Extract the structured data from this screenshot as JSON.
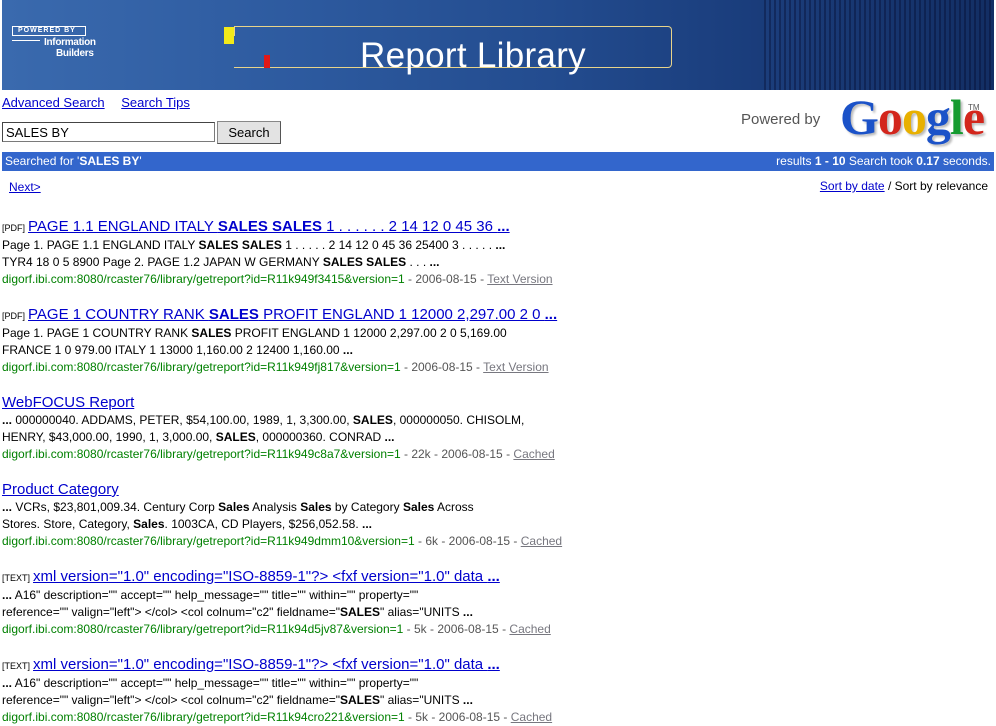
{
  "banner": {
    "logo_line1": "POWERED BY",
    "logo_line2": "Information",
    "logo_line3": "Builders",
    "title": "Report Library"
  },
  "links": {
    "advanced": "Advanced Search",
    "tips": "Search Tips"
  },
  "search": {
    "value": "SALES BY",
    "button": "Search"
  },
  "powered": {
    "text": "Powered by",
    "google": [
      "G",
      "o",
      "o",
      "g",
      "l",
      "e"
    ],
    "tm": "TM"
  },
  "bar": {
    "searched_prefix": "Searched for '",
    "query": "SALES BY",
    "searched_suffix": "'",
    "results_prefix": "results ",
    "range": "1 - 10",
    "took_prefix": " Search took ",
    "seconds": "0.17",
    "took_suffix": " seconds."
  },
  "nav": {
    "next": "Next>",
    "sort_date": "Sort by date",
    "sort_rel": " / Sort by relevance"
  },
  "results": [
    {
      "type": "[PDF]",
      "title": [
        [
          "PAGE 1.1 ENGLAND ITALY ",
          false
        ],
        [
          "SALES SALES",
          true
        ],
        [
          " 1 . . . . . . 2 14 12 0 45 36 ",
          false
        ],
        [
          "...",
          true
        ]
      ],
      "lines": [
        [
          [
            "Page 1. PAGE 1.1 ENGLAND ITALY ",
            false
          ],
          [
            "SALES SALES",
            true
          ],
          [
            " 1 . . . . . 2 14 12 0 45 36 25400 3 . . . . . ",
            false
          ],
          [
            "...",
            true
          ]
        ],
        [
          [
            "TYR4 18 0 5 8900 Page 2. PAGE 1.2 JAPAN W GERMANY ",
            false
          ],
          [
            "SALES SALES",
            true
          ],
          [
            " . . . ",
            false
          ],
          [
            "...",
            true
          ]
        ]
      ],
      "url": "digorf.ibi.com:8080/rcaster76/library/getreport?id=R11k949f3415&version=1",
      "meta": " - 2006-08-15 - ",
      "link": "Text Version"
    },
    {
      "type": "[PDF]",
      "title": [
        [
          "PAGE 1 COUNTRY RANK ",
          false
        ],
        [
          "SALES",
          true
        ],
        [
          " PROFIT ENGLAND 1 12000 2,297.00 2 0 ",
          false
        ],
        [
          "...",
          true
        ]
      ],
      "lines": [
        [
          [
            "Page 1. PAGE 1 COUNTRY RANK ",
            false
          ],
          [
            "SALES",
            true
          ],
          [
            " PROFIT ENGLAND 1 12000 2,297.00 2 0 5,169.00",
            false
          ]
        ],
        [
          [
            "FRANCE 1 0 979.00 ITALY 1 13000 1,160.00 2 12400 1,160.00 ",
            false
          ],
          [
            "...",
            true
          ]
        ]
      ],
      "url": "digorf.ibi.com:8080/rcaster76/library/getreport?id=R11k949fj817&version=1",
      "meta": " - 2006-08-15 - ",
      "link": "Text Version"
    },
    {
      "type": "",
      "title": [
        [
          "WebFOCUS Report",
          false
        ]
      ],
      "lines": [
        [
          [
            "...",
            true
          ],
          [
            " 000000040. ADDAMS, PETER, $54,100.00, 1989, 1, 3,300.00, ",
            false
          ],
          [
            "SALES",
            true
          ],
          [
            ", 000000050. CHISOLM,",
            false
          ]
        ],
        [
          [
            "HENRY, $43,000.00, 1990, 1, 3,000.00, ",
            false
          ],
          [
            "SALES",
            true
          ],
          [
            ", 000000360. CONRAD ",
            false
          ],
          [
            "...",
            true
          ]
        ]
      ],
      "url": "digorf.ibi.com:8080/rcaster76/library/getreport?id=R11k949c8a7&version=1",
      "meta": " - 22k - 2006-08-15 - ",
      "link": "Cached"
    },
    {
      "type": "",
      "title": [
        [
          "Product Category",
          false
        ]
      ],
      "lines": [
        [
          [
            "...",
            true
          ],
          [
            " VCRs, $23,801,009.34. Century Corp ",
            false
          ],
          [
            "Sales",
            true
          ],
          [
            " Analysis ",
            false
          ],
          [
            "Sales",
            true
          ],
          [
            " by Category ",
            false
          ],
          [
            "Sales",
            true
          ],
          [
            " Across",
            false
          ]
        ],
        [
          [
            "Stores. Store, Category, ",
            false
          ],
          [
            "Sales",
            true
          ],
          [
            ". 1003CA, CD Players, $256,052.58. ",
            false
          ],
          [
            "...",
            true
          ]
        ]
      ],
      "url": "digorf.ibi.com:8080/rcaster76/library/getreport?id=R11k949dmm10&version=1",
      "meta": " - 6k - 2006-08-15 - ",
      "link": "Cached"
    },
    {
      "type": "[TEXT]",
      "title": [
        [
          "xml version=\"1.0\" encoding=\"ISO-8859-1\"?> <fxf version=\"1.0\" data ",
          false
        ],
        [
          "...",
          true
        ]
      ],
      "lines": [
        [
          [
            "...",
            true
          ],
          [
            " A16\" description=\"\" accept=\"\" help_message=\"\" title=\"\" within=\"\" property=\"\"",
            false
          ]
        ],
        [
          [
            "reference=\"\" valign=\"left\"> </col> <col colnum=\"c2\" fieldname=\"",
            false
          ],
          [
            "SALES",
            true
          ],
          [
            "\" alias=\"UNITS ",
            false
          ],
          [
            "...",
            true
          ]
        ]
      ],
      "url": "digorf.ibi.com:8080/rcaster76/library/getreport?id=R11k94d5jv87&version=1",
      "meta": " - 5k - 2006-08-15 - ",
      "link": "Cached"
    },
    {
      "type": "[TEXT]",
      "title": [
        [
          "xml version=\"1.0\" encoding=\"ISO-8859-1\"?> <fxf version=\"1.0\" data ",
          false
        ],
        [
          "...",
          true
        ]
      ],
      "lines": [
        [
          [
            "...",
            true
          ],
          [
            " A16\" description=\"\" accept=\"\" help_message=\"\" title=\"\" within=\"\" property=\"\"",
            false
          ]
        ],
        [
          [
            "reference=\"\" valign=\"left\"> </col> <col colnum=\"c2\" fieldname=\"",
            false
          ],
          [
            "SALES",
            true
          ],
          [
            "\" alias=\"UNITS ",
            false
          ],
          [
            "...",
            true
          ]
        ]
      ],
      "url": "digorf.ibi.com:8080/rcaster76/library/getreport?id=R11k94cro221&version=1",
      "meta": " - 5k - 2006-08-15 - ",
      "link": "Cached"
    }
  ]
}
